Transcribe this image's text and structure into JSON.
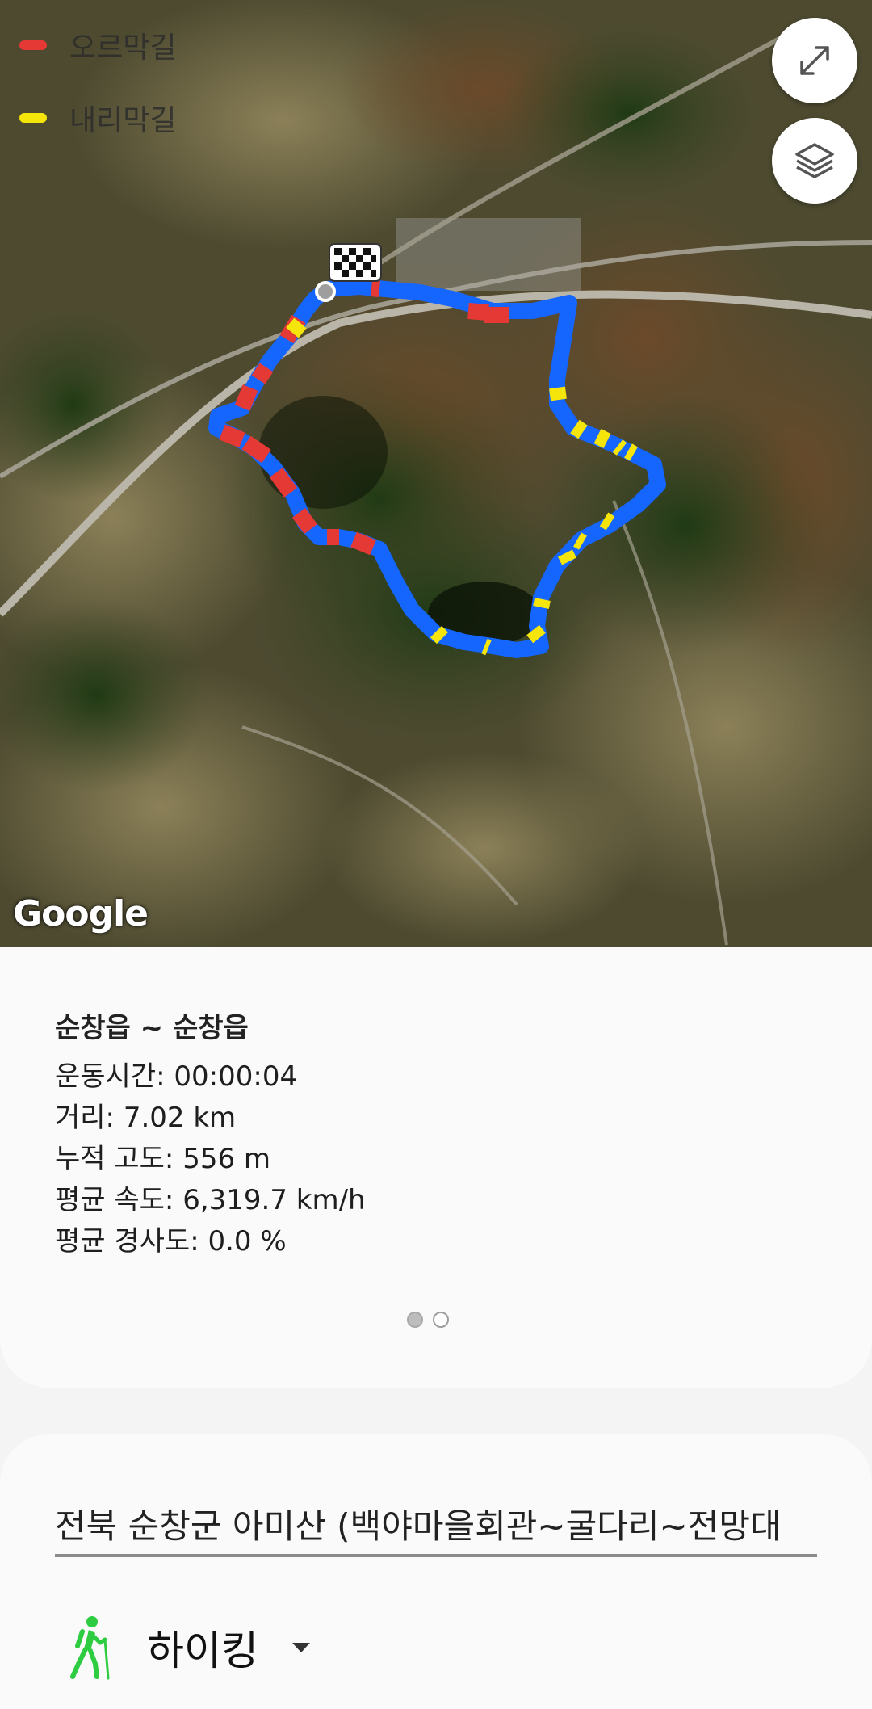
{
  "map": {
    "legend": [
      {
        "label": "오르막길",
        "color": "#e53935"
      },
      {
        "label": "내리막길",
        "color": "#f5e50a"
      }
    ],
    "route_color": "#1565ff",
    "attribution": "Google",
    "buttons": {
      "fullscreen_icon": "expand-icon",
      "layers_icon": "layers-icon"
    }
  },
  "summary": {
    "route_name": "순창읍 ~ 순창읍",
    "stats": [
      "운동시간: 00:00:04",
      "거리: 7.02 km",
      "누적 고도: 556 m",
      "평균 속도: 6,319.7 km/h",
      "평균 경사도: 0.0 %"
    ],
    "page_count": 2,
    "current_page": 1
  },
  "detail": {
    "title_value": "전북 순창군 아미산 (백야마을회관~굴다리~전망대",
    "activity_label": "하이킹",
    "activity_icon": "hiking-icon"
  }
}
